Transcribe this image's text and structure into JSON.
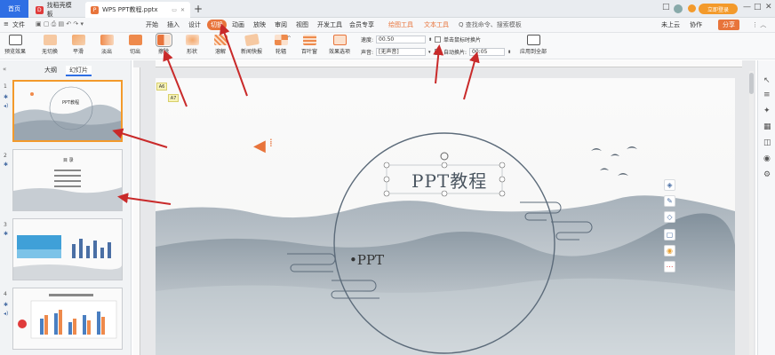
{
  "tabs": {
    "home": "首页",
    "template": "找稻壳模板",
    "document": "WPS PPT教程.pptx",
    "new_tab": "+"
  },
  "window": {
    "login": "立即登录",
    "controls": [
      "□",
      "—",
      "□",
      "✕"
    ]
  },
  "menubar": {
    "file": "文件",
    "items": [
      "开始",
      "插入",
      "设计",
      "切换",
      "动画",
      "放映",
      "审阅",
      "视图",
      "开发工具",
      "会员专享",
      "绘图工具",
      "文本工具"
    ],
    "search": "Q 查找命令、搜索模板",
    "cloud": "未上云",
    "collab": "协作",
    "share": "分享"
  },
  "ribbon": {
    "preview": "预览效果",
    "effects": [
      "无切换",
      "平滑",
      "淡出",
      "切出",
      "擦除",
      "形状",
      "溶解",
      "新闻快报",
      "轮辐",
      "百叶窗"
    ],
    "effect_options": "效果选项",
    "speed_label": "速度:",
    "speed_value": "00.50",
    "sound_label": "声音:",
    "sound_value": "[无声音]",
    "mouse_click": "单击鼠标时换片",
    "auto_advance": "自动换片:",
    "auto_value": "00:05",
    "apply_all": "应用到全部"
  },
  "left_panel": {
    "outline_tab": "大纲",
    "slides_tab": "幻灯片",
    "slide_numbers": [
      "1",
      "2",
      "3",
      "4"
    ],
    "thumb1_title": "PPT教程",
    "thumb2_title": "目 录"
  },
  "slide": {
    "title": "PPT教程",
    "subtitle": "•PPT",
    "tags": [
      "A6",
      "A7"
    ]
  },
  "colors": {
    "accent_blue": "#2f6fe4",
    "accent_orange": "#e8743b",
    "arrow_red": "#c92a2a",
    "ink": "#5c6b7a"
  },
  "chart_data": []
}
